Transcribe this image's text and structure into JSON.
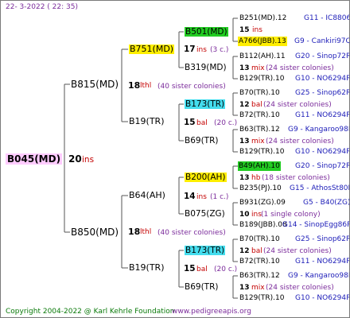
{
  "header": {
    "date": "22-  3-2022  ( 22:  35)"
  },
  "footer": {
    "copyright": "Copyright 2004-2022 @ Karl Kehrle Foundation",
    "site": "www.pedigreeapis.org"
  },
  "root": {
    "name": "B045(MD)",
    "ins_num": "20",
    "ins": "ins"
  },
  "gen1": {
    "top": {
      "name": "B815(MD)",
      "num": "18",
      "suffix": "lthl",
      "colonies": "(40 sister colonies)"
    },
    "bottom": {
      "name": "B850(MD)",
      "num": "18",
      "suffix": "lthl",
      "colonies": "(40 sister colonies)"
    }
  },
  "gen2": {
    "a": {
      "name": "B751(MD)",
      "num": "17",
      "suffix": "ins",
      "colonies": "(3 c.)"
    },
    "b": {
      "name": "B19(TR)",
      "num": "15",
      "suffix": "bal",
      "colonies": "(20 c.)"
    },
    "c": {
      "name": "B64(AH)",
      "num": "14",
      "suffix": "ins",
      "colonies": "(1 c.)"
    },
    "d": {
      "name": "B19(TR)",
      "num": "15",
      "suffix": "bal",
      "colonies": "(20 c.)"
    }
  },
  "gen3": [
    {
      "name": "B501(MD)"
    },
    {
      "name": "B319(MD)"
    },
    {
      "name": "B173(TR)"
    },
    {
      "name": "B69(TR)"
    },
    {
      "name": "B200(AH)"
    },
    {
      "name": "B075(ZG)"
    },
    {
      "name": "B173(TR)"
    },
    {
      "name": "B69(TR)"
    }
  ],
  "gen4": [
    {
      "l1": "B251(MD).12",
      "l1r": "G11 - IC8806",
      "num": "15",
      "suf": "ins",
      "l3": "A766(JBB).13",
      "l3r": "G9 - Cankiri97Q"
    },
    {
      "l1": "B112(AH).11",
      "l1r": "G20 - Sinop72R",
      "num": "13",
      "suf": "mix",
      "col": "(24 sister colonies)",
      "l3": "B129(TR).10",
      "l3r": "G10 - NO6294R"
    },
    {
      "l1": "B70(TR).10",
      "l1r": "G25 - Sinop62R",
      "num": "12",
      "suf": "bal",
      "col": "(24 sister colonies)",
      "l3": "B72(TR).10",
      "l3r": "G11 - NO6294R"
    },
    {
      "l1": "B63(TR).12",
      "l1r": "G9 - Kangaroo98R",
      "num": "13",
      "suf": "mix",
      "col": "(24 sister colonies)",
      "l3": "B129(TR).10",
      "l3r": "G10 - NO6294R"
    },
    {
      "l1": "B49(AH).10",
      "l1r": "G20 - Sinop72R",
      "num": "13",
      "suf": "hb",
      "col": "(18 sister colonies)",
      "l3": "B235(PJ).10",
      "l3r": "G15 - AthosSt80R"
    },
    {
      "l1": "B931(ZG).09",
      "l1r": "G5 - B40(ZG)",
      "num": "10",
      "suf": "ins",
      "col": "(1 single colony)",
      "l3": "B189(JBB).08",
      "l3r": "G14 - SinopEgg86R"
    },
    {
      "l1": "B70(TR).10",
      "l1r": "G25 - Sinop62R",
      "num": "12",
      "suf": "bal",
      "col": "(24 sister colonies)",
      "l3": "B72(TR).10",
      "l3r": "G11 - NO6294R"
    },
    {
      "l1": "B63(TR).12",
      "l1r": "G9 - Kangaroo98R",
      "num": "13",
      "suf": "mix",
      "col": "(24 sister colonies)",
      "l3": "B129(TR).10",
      "l3r": "G10 - NO6294R"
    }
  ]
}
